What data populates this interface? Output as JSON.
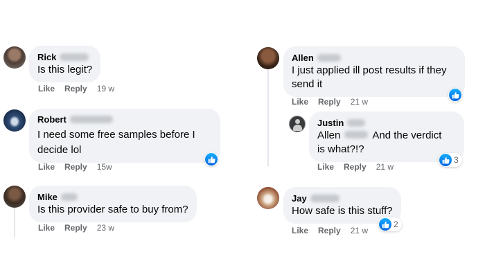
{
  "actions": {
    "like": "Like",
    "reply": "Reply"
  },
  "colors": {
    "bubble": "#f0f2f5",
    "like_blue": "#0866ff",
    "secondary_text": "#65676b"
  },
  "comments": {
    "rick": {
      "name": "Rick",
      "text": "Is this legit?",
      "time": "19 w"
    },
    "robert": {
      "name": "Robert",
      "text_line1": "I need some free samples before I",
      "text_line2": "decide lol",
      "time": "15w",
      "reaction_icon": "like-icon"
    },
    "mike": {
      "name": "Mike",
      "text": "Is this provider safe to buy from?",
      "time": "23 w"
    },
    "allen": {
      "name": "Allen",
      "text_line1": "I just applied ill post results if they",
      "text_line2": "send it",
      "time": "21 w",
      "reaction_icon": "like-icon"
    },
    "justin": {
      "name": "Justin",
      "mention": "Allen",
      "text_line1_rest": "And the verdict",
      "text_line2": "is what?!?",
      "time": "21 w",
      "reaction_icon": "like-icon",
      "reaction_count": "3"
    },
    "jay": {
      "name": "Jay",
      "text": "How safe is this stuff?",
      "time": "21 w",
      "reaction_icon": "like-icon",
      "reaction_count": "2"
    }
  }
}
